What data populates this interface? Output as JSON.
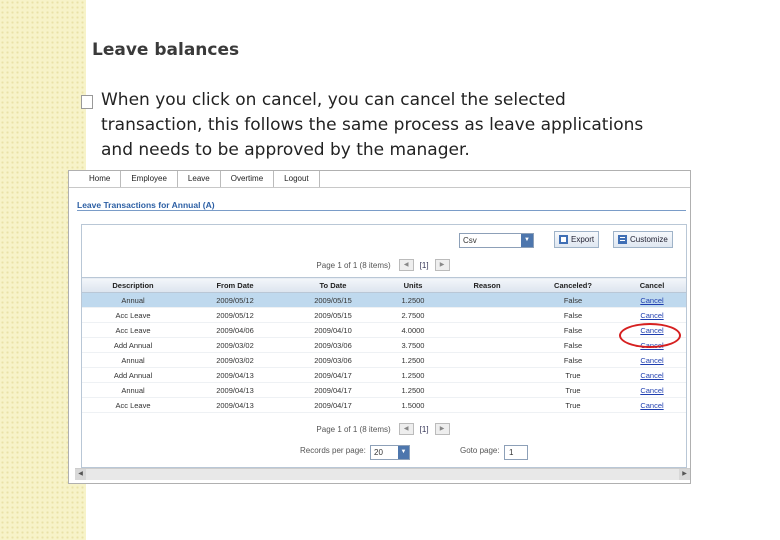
{
  "slide": {
    "title": "Leave balances",
    "bullet": "When you click on cancel, you can cancel the selected transaction, this follows the same process as leave applications and needs to be approved by the manager."
  },
  "nav": [
    "Home",
    "Employee",
    "Leave",
    "Overtime",
    "Logout"
  ],
  "page_heading": "Leave Transactions for Annual (A)",
  "toolbar": {
    "format_value": "Csv",
    "export_label": "Export",
    "customize_label": "Customize"
  },
  "pager": {
    "text": "Page 1 of 1 (8 items)",
    "current": "[1]"
  },
  "table": {
    "columns": [
      "Description",
      "From Date",
      "To Date",
      "Units",
      "Reason",
      "Canceled?",
      "Cancel"
    ],
    "rows": [
      {
        "description": "Annual",
        "from": "2009/05/12",
        "to": "2009/05/15",
        "units": "1.2500",
        "reason": "",
        "canceled": "False",
        "cancel": "Cancel"
      },
      {
        "description": "Acc Leave",
        "from": "2009/05/12",
        "to": "2009/05/15",
        "units": "2.7500",
        "reason": "",
        "canceled": "False",
        "cancel": "Cancel"
      },
      {
        "description": "Acc Leave",
        "from": "2009/04/06",
        "to": "2009/04/10",
        "units": "4.0000",
        "reason": "",
        "canceled": "False",
        "cancel": "Cancel"
      },
      {
        "description": "Add Annual",
        "from": "2009/03/02",
        "to": "2009/03/06",
        "units": "3.7500",
        "reason": "",
        "canceled": "False",
        "cancel": "Cancel"
      },
      {
        "description": "Annual",
        "from": "2009/03/02",
        "to": "2009/03/06",
        "units": "1.2500",
        "reason": "",
        "canceled": "False",
        "cancel": "Cancel"
      },
      {
        "description": "Add Annual",
        "from": "2009/04/13",
        "to": "2009/04/17",
        "units": "1.2500",
        "reason": "",
        "canceled": "True",
        "cancel": "Cancel"
      },
      {
        "description": "Annual",
        "from": "2009/04/13",
        "to": "2009/04/17",
        "units": "1.2500",
        "reason": "",
        "canceled": "True",
        "cancel": "Cancel"
      },
      {
        "description": "Acc Leave",
        "from": "2009/04/13",
        "to": "2009/04/17",
        "units": "1.5000",
        "reason": "",
        "canceled": "True",
        "cancel": "Cancel"
      }
    ]
  },
  "footer": {
    "records_label": "Records per page:",
    "records_value": "20",
    "goto_label": "Goto page:",
    "goto_value": "1"
  },
  "colors": {
    "accent": "#2c5fa4",
    "selected_row": "#bfd9ee",
    "annotation": "#d62020"
  },
  "icons": [
    "export-icon",
    "customize-icon",
    "dropdown-arrow-icon",
    "pager-prev-icon",
    "pager-next-icon"
  ]
}
